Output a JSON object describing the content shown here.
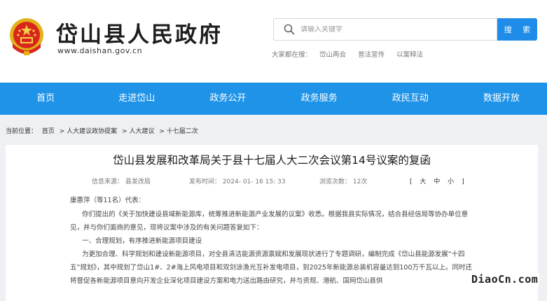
{
  "header": {
    "site_title": "岱山县人民政府",
    "site_url": "www.daishan.gov.cn",
    "search_placeholder": "请输入关键字",
    "search_button": "搜 索",
    "hot_label": "大家都在搜：",
    "hot_links": [
      "岱山两会",
      "普法宣传",
      "以案释法"
    ]
  },
  "nav": [
    "首页",
    "走进岱山",
    "政务公开",
    "政务服务",
    "政民互动",
    "数据开放"
  ],
  "breadcrumb": {
    "label": "当前位置：",
    "items": [
      "首页",
      "> 人大建议政协提案",
      "> 人大建议",
      "> 十七届二次"
    ]
  },
  "article": {
    "title": "岱山县发展和改革局关于县十七届人大二次会议第14号议案的复函",
    "source": "信息来源： 县发改局",
    "publish_time": "发布时间： 2024- 01- 16 15: 33",
    "views": "浏览次数： 12次",
    "font_size": {
      "open": "[",
      "large": "大",
      "medium": "中",
      "small": "小",
      "close": "]"
    },
    "salutation": "康惠萍（等11名）代表：",
    "paragraphs": [
      "你们提出的《关于加快建设县域新能源库，统筹推进新能源产业发展的议案》收悉。根据我县实际情况，结合县经信局等协办单位意见，并与你们面商的意见，现将议案中涉及的有关问题答复如下：",
      "一、合理规划，有序推进新能源项目建设",
      "为更加合理、科学规划和建设新能源项目，对全县清洁能源资源禀赋和发展现状进行了专题调研，编制完成《岱山县能源发展“十四五”规划》，其中规划了岱山1#、2#海上风电项目和双剑涂渔光互补发电项目，到2025年新能源总装机容量达到100万千瓦以上。同时还将督促各新能源项目意向开发企业深化项目建设方案和电力送出路由研究，并与资规、港航、国网岱山县供"
    ]
  },
  "watermark": "DiaoCn.com",
  "colors": {
    "primary": "#1f93e8",
    "search_button": "#1e8ce8"
  }
}
